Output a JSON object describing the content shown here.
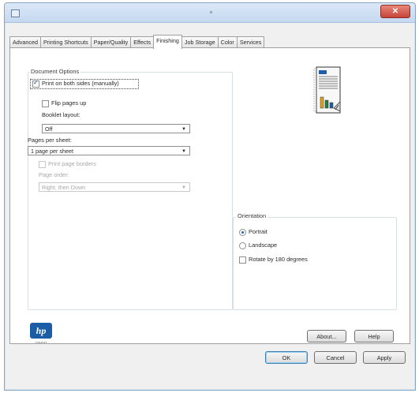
{
  "window": {
    "title": ""
  },
  "tabs": [
    {
      "label": "Advanced"
    },
    {
      "label": "Printing Shortcuts"
    },
    {
      "label": "Paper/Quality"
    },
    {
      "label": "Effects"
    },
    {
      "label": "Finishing"
    },
    {
      "label": "Job Storage"
    },
    {
      "label": "Color"
    },
    {
      "label": "Services"
    }
  ],
  "active_tab": "Finishing",
  "document_options": {
    "label": "Document Options",
    "print_both_sides": {
      "label": "Print on both sides (manually)",
      "checked": true
    },
    "flip_pages_up": {
      "label": "Flip pages up",
      "checked": false
    },
    "booklet_layout": {
      "label": "Booklet layout:",
      "value": "Off"
    },
    "pages_per_sheet": {
      "label": "Pages per sheet:",
      "value": "1 page per sheet"
    },
    "print_page_borders": {
      "label": "Print page borders",
      "checked": false
    },
    "page_order": {
      "label": "Page order:",
      "value": "Right, then Down"
    }
  },
  "orientation": {
    "label": "Orientation",
    "options": [
      {
        "label": "Portrait",
        "selected": true
      },
      {
        "label": "Landscape",
        "selected": false
      }
    ],
    "rotate": {
      "label": "Rotate by 180 degrees",
      "checked": false
    }
  },
  "buttons": {
    "about": "About...",
    "help": "Help",
    "ok": "OK",
    "cancel": "Cancel",
    "apply": "Apply"
  },
  "logo": {
    "text": "hp",
    "tagline": "i n v e n t"
  },
  "colors": {
    "accent": "#2a5fb0",
    "close_button": "#c6453a",
    "tab_border": "#a0a0a0"
  },
  "icons": [
    "printer-icon",
    "close-icon",
    "page-preview-icon",
    "hp-logo-icon",
    "chevron-down-icon"
  ]
}
